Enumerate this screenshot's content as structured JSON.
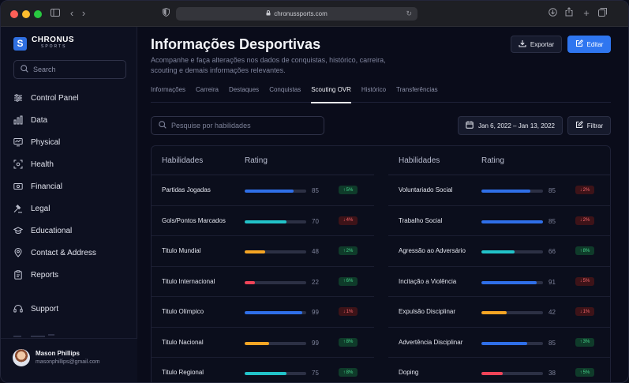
{
  "browser": {
    "url": "chronussports.com"
  },
  "brand": {
    "name": "CHRONUS",
    "sub": "SPORTS"
  },
  "sidebar": {
    "search_placeholder": "Search",
    "items": [
      {
        "label": "Control Panel",
        "icon": "sliders-icon"
      },
      {
        "label": "Data",
        "icon": "bar-chart-icon"
      },
      {
        "label": "Physical",
        "icon": "monitor-icon"
      },
      {
        "label": "Health",
        "icon": "scan-icon"
      },
      {
        "label": "Financial",
        "icon": "cash-icon"
      },
      {
        "label": "Legal",
        "icon": "gavel-icon"
      },
      {
        "label": "Educational",
        "icon": "graduation-cap-icon"
      },
      {
        "label": "Contact & Address",
        "icon": "location-pin-icon"
      },
      {
        "label": "Reports",
        "icon": "clipboard-icon"
      }
    ],
    "support_label": "Support",
    "user": {
      "name": "Mason Phillips",
      "email": "masonphillips@gmail.com"
    }
  },
  "header": {
    "title": "Informações Desportivas",
    "subtitle": "Acompanhe e faça alterações nos dados de conquistas, histórico, carreira, scouting e demais informações relevantes.",
    "export_label": "Exportar",
    "edit_label": "Editar"
  },
  "tabs": [
    {
      "label": "Informações",
      "active": false
    },
    {
      "label": "Carreira",
      "active": false
    },
    {
      "label": "Destaques",
      "active": false
    },
    {
      "label": "Conquistas",
      "active": false
    },
    {
      "label": "Scouting OVR",
      "active": true
    },
    {
      "label": "Histórico",
      "active": false
    },
    {
      "label": "Transferências",
      "active": false
    }
  ],
  "filters": {
    "skill_search_placeholder": "Pesquise por habilidades",
    "date_range": "Jan 6, 2022 – Jan 13, 2022",
    "filter_label": "Filtrar"
  },
  "table": {
    "headers": {
      "skill": "Habilidades",
      "rating": "Rating"
    },
    "colors": {
      "blue": "#2f6fe8",
      "teal": "#22c3c9",
      "orange": "#f5a524",
      "red": "#f04458"
    },
    "left": [
      {
        "name": "Partidas Jogadas",
        "value": 85,
        "bar_fraction": 0.8,
        "bar": "blue",
        "trend": "up",
        "change": "5%"
      },
      {
        "name": "Gols/Pontos Marcados",
        "value": 70,
        "bar_fraction": 0.68,
        "bar": "teal",
        "trend": "down",
        "change": "4%"
      },
      {
        "name": "Titulo Mundial",
        "value": 48,
        "bar_fraction": 0.33,
        "bar": "orange",
        "trend": "up",
        "change": "2%"
      },
      {
        "name": "Titulo Internacional",
        "value": 22,
        "bar_fraction": 0.17,
        "bar": "red",
        "trend": "up",
        "change": "6%"
      },
      {
        "name": "Titulo Olímpico",
        "value": 99,
        "bar_fraction": 0.93,
        "bar": "blue",
        "trend": "down",
        "change": "1%"
      },
      {
        "name": "Titulo Nacional",
        "value": 99,
        "bar_fraction": 0.4,
        "bar": "orange",
        "trend": "up",
        "change": "8%"
      },
      {
        "name": "Titulo Regional",
        "value": 75,
        "bar_fraction": 0.68,
        "bar": "teal",
        "trend": "up",
        "change": "8%"
      }
    ],
    "right": [
      {
        "name": "Voluntariado Social",
        "value": 85,
        "bar_fraction": 0.8,
        "bar": "blue",
        "trend": "down",
        "change": "2%"
      },
      {
        "name": "Trabalho Social",
        "value": 85,
        "bar_fraction": 1.0,
        "bar": "blue",
        "trend": "down",
        "change": "2%"
      },
      {
        "name": "Agressão ao Adversário",
        "value": 66,
        "bar_fraction": 0.54,
        "bar": "teal",
        "trend": "up",
        "change": "8%"
      },
      {
        "name": "Incitação a Violência",
        "value": 91,
        "bar_fraction": 0.9,
        "bar": "blue",
        "trend": "down",
        "change": "5%"
      },
      {
        "name": "Expulsão Disciplinar",
        "value": 42,
        "bar_fraction": 0.41,
        "bar": "orange",
        "trend": "down",
        "change": "1%"
      },
      {
        "name": "Advertência Disciplinar",
        "value": 85,
        "bar_fraction": 0.74,
        "bar": "blue",
        "trend": "up",
        "change": "3%"
      },
      {
        "name": "Doping",
        "value": 38,
        "bar_fraction": 0.35,
        "bar": "red",
        "trend": "up",
        "change": "5%"
      }
    ]
  }
}
